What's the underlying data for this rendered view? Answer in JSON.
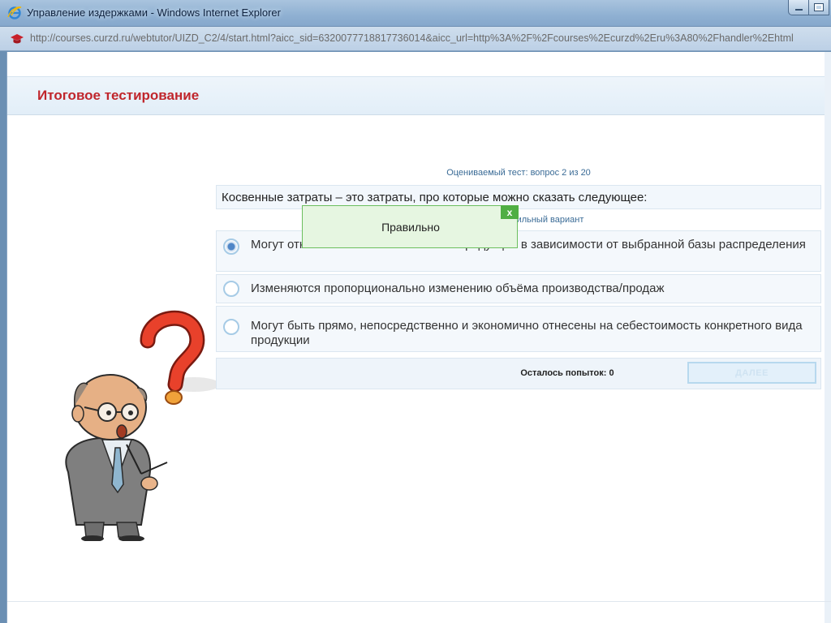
{
  "window": {
    "title": "Управление издержками - Windows Internet Explorer",
    "url": "http://courses.curzd.ru/webtutor/UIZD_C2/4/start.html?aicc_sid=6320077718817736014&aicc_url=http%3A%2F%2Fcourses%2Ecurzd%2Eru%3A80%2Fhandler%2Ehtml"
  },
  "page": {
    "title": "Итоговое тестирование"
  },
  "quiz": {
    "counter": "Оцениваемый тест: вопрос 2 из 20",
    "question": "Косвенные затраты – это затраты, про которые можно сказать следующее:",
    "instruction": "Выберите правильный вариант",
    "options": [
      {
        "text": "Могут относиться на себестоимость продукции в зависимости от выбранной базы распределения",
        "selected": true
      },
      {
        "text": "Изменяются пропорционально изменению объёма производства/продаж",
        "selected": false
      },
      {
        "text": "Могут быть прямо, непосредственно и экономично отнесены на себестоимость конкретного вида продукции",
        "selected": false
      }
    ],
    "attempts_label": "Осталось попыток:",
    "attempts_value": "0",
    "next_label": "ДАЛЕЕ"
  },
  "feedback": {
    "text": "Правильно",
    "close_label": "x"
  },
  "colors": {
    "title_red": "#c0262c",
    "link_blue": "#3a6b96",
    "correct_green": "#4fae43"
  }
}
